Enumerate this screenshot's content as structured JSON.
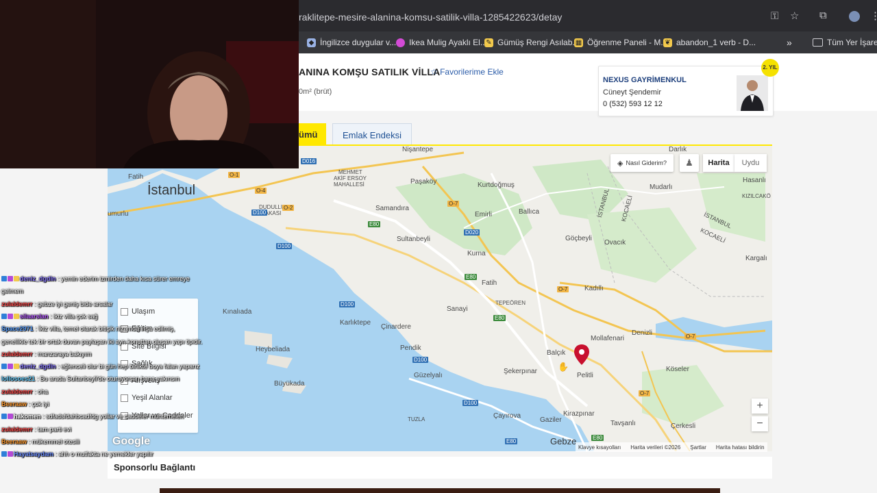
{
  "browser": {
    "url": "raklitepe-mesire-alanina-komsu-satilik-villa-1285422623/detay",
    "bookmarks": [
      {
        "label": "İngilizce duygular v...",
        "icon": "hat-icon",
        "color": "#9ab3e6"
      },
      {
        "label": "Ikea Mulig Ayaklı El...",
        "icon": "circle-icon",
        "color": "#d34bd6"
      },
      {
        "label": "Gümüş Rengi Asılab...",
        "icon": "tag-icon",
        "color": "#f2c94c"
      },
      {
        "label": "Öğrenme Paneli - M...",
        "icon": "panel-icon",
        "color": "#f2c94c"
      },
      {
        "label": "abandon_1 verb - D...",
        "icon": "leaf-icon",
        "color": "#f2c94c"
      }
    ],
    "all_bookmarks": "Tüm Yer İşaretleri",
    "more_symbol": "»"
  },
  "listing": {
    "title": "ANINA KOMŞU SATILIK VİLLA",
    "favorite_label": "Favorilerime Ekle",
    "area_text": "0m² (brüt)"
  },
  "agent": {
    "company": "NEXUS GAYRİMENKUL",
    "name": "Cüneyt Şendemir",
    "phone": "0 (532) 593 12 12",
    "badge": "2. YIL"
  },
  "tabs": {
    "active": "ümü",
    "second": "Emlak Endeksi"
  },
  "map": {
    "controls": {
      "directions": "Nasıl Giderim?",
      "map": "Harita",
      "satellite": "Uydu",
      "zoom_in": "+",
      "zoom_out": "−"
    },
    "google": "Google",
    "attribution": [
      "Klavye kısayolları",
      "Harita verileri ©2026",
      "Şartlar",
      "Harita hatası bildirin"
    ],
    "labels": {
      "istanbul": "İstanbul",
      "fatih1": "Fatih",
      "umurlu": "umurlu",
      "nisantepe": "Nişantepe",
      "mehmet_akif": "MEHMET",
      "mehmet_akif2": "AKİF ERSOY",
      "mehmet_akif3": "MAHALLESİ",
      "pasakoy": "Paşaköy",
      "kurtdogmus": "Kurtdoğmuş",
      "darlik": "Darlık",
      "hasanli": "Hasanlı",
      "mudarli": "Mudarlı",
      "kizilcakoy": "KIZILCAKÖ",
      "samandira": "Samandıra",
      "emirli": "Emirli",
      "ballica": "Ballıca",
      "sultanbeyli": "Sultanbeyli",
      "gocbeyli": "Göçbeyli",
      "ovacik": "Ovacık",
      "kargali": "Kargalı",
      "dudullu": "DUDULLU",
      "dudullu2": "YAKASI",
      "kurna": "Kurna",
      "fatih2": "Fatih",
      "kadilli": "Kadıllı",
      "tepeoren": "TEPEÖREN",
      "sanayi": "Sanayi",
      "kinalada": "Kınalıada",
      "karliktepe": "Karlıktepe",
      "cinardere": "Çinardere",
      "mollafenari": "Mollafenari",
      "denizli": "Denizli",
      "heybeliada": "Heybeliada",
      "pendik": "Pendik",
      "balcik": "Balçık",
      "pelitli": "Pelitli",
      "sekerpinar": "Şekerpınar",
      "koseler": "Köseler",
      "buyukada": "Büyükada",
      "guzelyali": "Güzelyalı",
      "kirazpinar": "Kirazpınar",
      "tuzla": "TUZLA",
      "cayirova": "Çayırova",
      "gebze": "Gebze",
      "gaziler": "Gaziler",
      "tavsanli": "Tavşanlı",
      "cerkesli": "Çerkesli",
      "istanbul_border": "İSTANBUL",
      "kocaeli_border": "KOCAELİ",
      "istanbul_border2": "İSTANBUL",
      "kocaeli_border2": "KOCAELİ"
    },
    "roads": [
      "D016",
      "O-1",
      "O-4",
      "O-2",
      "D100",
      "E80",
      "O-7",
      "D020",
      "E80",
      "O-7",
      "D100",
      "E80",
      "D100",
      "D100",
      "O-7",
      "O-7",
      "E80",
      "D100",
      "E80"
    ]
  },
  "filters": [
    "Ulaşım",
    "Eğitim",
    "Site Bilgisi",
    "Sağlık",
    "Alışveriş",
    "Yeşil Alanlar",
    "Yollar ve Caddeler"
  ],
  "sponsor": "Sponsorlu Bağlantı",
  "chat": [
    {
      "user": "deniz_dgdln",
      "color": "#8b7bff",
      "badges": 3,
      "text": " : yemin ederim izmirden daha kısa sürer emreye"
    },
    {
      "user": "",
      "color": "#ffffff",
      "badges": 0,
      "text": "gelmem"
    },
    {
      "user": "zulaldemrr",
      "color": "#ff4b4b",
      "badges": 0,
      "text": " : gebze iyi geniş bide arsalar"
    },
    {
      "user": "silaarslan",
      "color": "#b65cff",
      "badges": 3,
      "text": " : ikiz villa çok sağ"
    },
    {
      "user": "Space2971",
      "color": "#5aa0ff",
      "badges": 0,
      "text": " : İkiz villa, temel olarak bitişik nizamda inşa edilmiş,"
    },
    {
      "user": "",
      "color": "#ffffff",
      "badges": 0,
      "text": "genellikle tek bir ortak duvarı paylaşan iki ayrı konuttan oluşan yapı tipidir."
    },
    {
      "user": "zulaldemrr",
      "color": "#ff4b4b",
      "badges": 0,
      "text": " : manzaraya bakıyım"
    },
    {
      "user": "deniz_dgdln",
      "color": "#8b7bff",
      "badges": 3,
      "text": " : eğlenceli olur bi gün hep birlikte boya falan yaparız"
    },
    {
      "user": "lollosoes21",
      "color": "#6ad0ff",
      "badges": 0,
      "text": " : Bu arada Sultanbeyli'de oturuyorsan bana yakınsın"
    },
    {
      "user": "zulaldemrr",
      "color": "#ff4b4b",
      "badges": 0,
      "text": " : oha"
    },
    {
      "user": "Beeraaw",
      "color": "#ff9a2e",
      "badges": 0,
      "text": " : çok iyi"
    },
    {
      "user": "hakomen",
      "color": "#ffffff",
      "badges": 2,
      "text": " : sdfadsfdahbcadfdg yollar ve caddeler muhtemelen"
    },
    {
      "user": "zulaldemrr",
      "color": "#ff4b4b",
      "badges": 0,
      "text": " : tam parti evi"
    },
    {
      "user": "Beeraaw",
      "color": "#ff9a2e",
      "badges": 0,
      "text": " : mükemmel otesiii"
    },
    {
      "user": "Hayatsaydam",
      "color": "#6a8cff",
      "badges": 2,
      "text": " : ahh o mutfakta ne yemekler yapılır"
    }
  ]
}
